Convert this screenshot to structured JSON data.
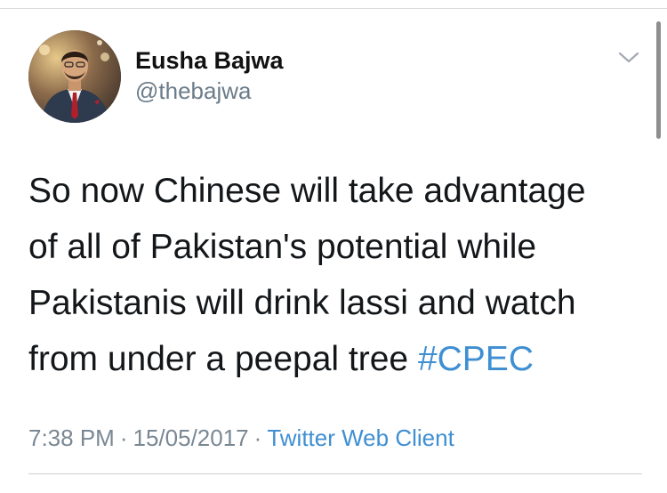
{
  "tweet": {
    "author": {
      "display_name": "Eusha Bajwa",
      "handle": "@thebajwa"
    },
    "text_lines": [
      "So now Chinese will take advantage",
      "of all of Pakistan's potential while",
      "Pakistanis will drink lassi and watch",
      "from under a peepal tree "
    ],
    "hashtag": "#CPEC",
    "time": "7:38 PM",
    "separator": "·",
    "date": "15/05/2017",
    "source": "Twitter Web Client"
  },
  "icons": {
    "menu": "chevron-down-icon"
  },
  "colors": {
    "link": "#3f8fd2",
    "secondary_text": "#6b7b88",
    "primary_text": "#14171a"
  }
}
